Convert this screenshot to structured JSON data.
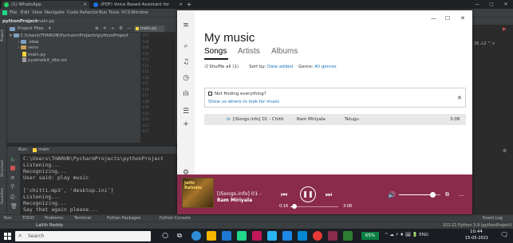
{
  "browser": {
    "tabs": [
      {
        "label": "(1) WhatsApp",
        "close": "×"
      },
      {
        "label": "(PDF) Voice Based Assistant for",
        "close": "×"
      }
    ],
    "new_tab": "+",
    "window_controls": [
      "—",
      "▢",
      "✕"
    ]
  },
  "ide": {
    "menu": [
      "File",
      "Edit",
      "View",
      "Navigate",
      "Code",
      "Refactor",
      "Run",
      "Tools",
      "VCS",
      "Window"
    ],
    "breadcrumb": "pythonProject",
    "breadcrumb_file": "main.py",
    "project_panel_title": "Project Files",
    "editor_tab": "main.py",
    "tree": [
      {
        "label": "C:\\Users\\THARUN\\PycharmProjects\\pythonProject",
        "kind": "folder"
      },
      {
        "label": ".idea",
        "kind": "folder"
      },
      {
        "label": "venv",
        "kind": "folder"
      },
      {
        "label": "main.py",
        "kind": "file"
      },
      {
        "label": "pywhatkit_dbs.txt",
        "kind": "file"
      }
    ],
    "line_numbers": [
      "107",
      "108",
      "109",
      "110",
      "111",
      "112",
      "113",
      "114",
      "115",
      "116",
      "117",
      "118",
      "119",
      "120",
      "121",
      "122",
      "123"
    ],
    "run_tab": "Run:",
    "run_config": "main",
    "left_strip_labels": [
      "Project",
      "Structure",
      "Favorites"
    ],
    "console_lines": [
      "C:\\Users\\THARUN\\PycharmProjects\\pythonProject",
      "Listening...",
      "Recognizing...",
      "User said: play music",
      "",
      "['chitti.mp3', 'desktop.ini']",
      "Listening...",
      "Recognizing...",
      "Say that again please..."
    ],
    "bottom_tabs": [
      "Run",
      "TODO",
      "Problems",
      "Terminal",
      "Python Packages",
      "Python Console"
    ],
    "event_log": "Event Log",
    "status_right": "102:21   Python 3.9 (pythonProject)",
    "status_left": "Lalith Reddy",
    "right_gutter": "26  ⚠2  ^  v"
  },
  "groove": {
    "window_controls": [
      "—",
      "☐",
      "✕"
    ],
    "title": "My music",
    "tabs": [
      "Songs",
      "Artists",
      "Albums"
    ],
    "shuffle": "Shuffle all (1)",
    "sort_label": "Sort by:",
    "sort_value": "Date added",
    "genre_label": "Genre:",
    "genre_value": "All genres",
    "notice_title": "Not finding everything?",
    "notice_link": "Show us where to look for music",
    "notice_close": "✕",
    "song": {
      "title": "[iSongs.info] 01 - Chitti",
      "artist": "Ram Miriyala",
      "genre": "Telugu",
      "duration": "3:08"
    },
    "player": {
      "album_art_text": "Jathi Ratnalu",
      "track": "[iSongs.info] 01 -",
      "artist": "Ram Miriyala",
      "elapsed": "0:16",
      "total": "3:08",
      "progress": 0.085,
      "volume": 0.8
    }
  },
  "taskbar": {
    "search_placeholder": "Search",
    "battery": "65%",
    "tray": "^  ☁  ⚡  ♦  🖼  🔋  ENG",
    "time": "10:44",
    "date": "15-05-2021",
    "colors": {
      "accent": "#8a2b4c",
      "taskbar": "#1a1d23",
      "ide_bg": "#3c3f41"
    }
  }
}
